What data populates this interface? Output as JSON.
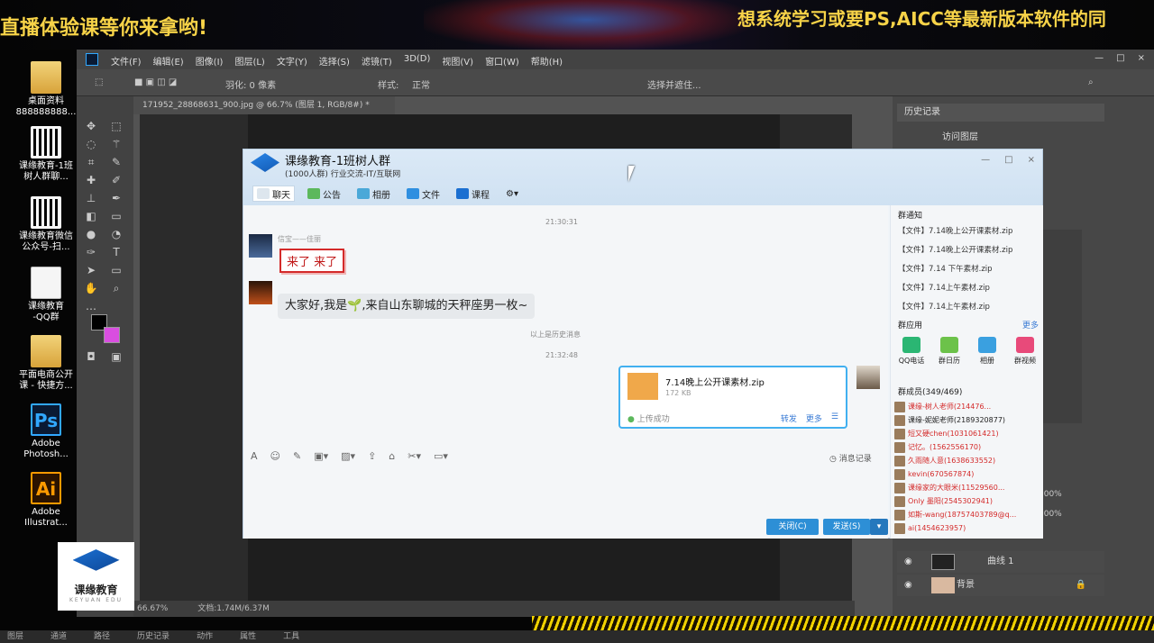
{
  "banner": {
    "left_text": "直播体验课等你来拿哟!",
    "right_text": "想系统学习或要PS,AICC等最新版本软件的同"
  },
  "desktop": {
    "icons": [
      {
        "label": "桌面资料\n888888888...",
        "kind": "folder"
      },
      {
        "label": "课缘教育-1班\n树人群聊...",
        "kind": "qr"
      },
      {
        "label": "课缘教育微信\n公众号-扫...",
        "kind": "qr"
      },
      {
        "label": "课缘教育\n-QQ群",
        "kind": "doc"
      },
      {
        "label": "平面电商公开\n课 - 快捷方...",
        "kind": "folder"
      },
      {
        "label": "Adobe\nPhotosh...",
        "kind": "ps"
      },
      {
        "label": "Adobe\nIllustrat...",
        "kind": "ai"
      }
    ],
    "logo_text": "课缘教育",
    "logo_sub": "KEYUAN EDU"
  },
  "photoshop": {
    "menus": [
      "文件(F)",
      "编辑(E)",
      "图像(I)",
      "图层(L)",
      "文字(Y)",
      "选择(S)",
      "滤镜(T)",
      "3D(D)",
      "视图(V)",
      "窗口(W)",
      "帮助(H)"
    ],
    "options": {
      "feather": "羽化: 0 像素",
      "style_label": "样式:",
      "style_value": "正常",
      "select_mask": "选择并遮住..."
    },
    "doc_tab": "171952_28868631_900.jpg @ 66.7% (图层 1, RGB/8#) *",
    "status": {
      "zoom": "66.67%",
      "doc": "文档:1.74M/6.37M"
    },
    "history_panel": "历史记录",
    "history_item": "访问图层",
    "layers": [
      {
        "name": "曲线 1"
      },
      {
        "name": "背景"
      }
    ],
    "opacity_values": [
      "100%",
      "100%"
    ]
  },
  "qq": {
    "title": "课缘教育-1班树人群",
    "subtitle": "(1000人群) 行业交流-IT/互联网",
    "tabs": [
      "聊天",
      "公告",
      "相册",
      "文件",
      "课程"
    ],
    "window_controls": [
      "—",
      "□",
      "×"
    ],
    "messages": {
      "time1": "21:30:31",
      "sender1": "信宝——佳丽",
      "sticker_text": "来了 来了",
      "bubble_text": "大家好,我是🌱,来自山东聊城的天秤座男一枚~",
      "hint": "以上是历史消息",
      "time2": "21:32:48"
    },
    "file": {
      "name": "7.14晚上公开课素材.zip",
      "size": "172 KB",
      "status": "上传成功",
      "actions": [
        "转发",
        "更多"
      ]
    },
    "toolbar_history": "消息记录",
    "buttons": {
      "close": "关闭(C)",
      "send": "发送(S)"
    },
    "side": {
      "notice_title": "群通知",
      "notices": [
        "【文件】7.14晚上公开课素材.zip",
        "【文件】7.14晚上公开课素材.zip",
        "【文件】7.14 下午素材.zip",
        "【文件】7.14上午素材.zip",
        "【文件】7.14上午素材.zip"
      ],
      "apps_title": "群应用",
      "apps_more": "更多",
      "apps": [
        "QQ电话",
        "群日历",
        "相册",
        "群视频"
      ],
      "members_title": "群成员(349/469)",
      "members": [
        {
          "name": "课缘-树人老师(214476...",
          "color": "#d42a2a"
        },
        {
          "name": "课缘-妮妮老师(2189320877)",
          "color": "#222222"
        },
        {
          "name": "短又硬chen(1031061421)",
          "color": "#d42a2a"
        },
        {
          "name": "记忆。(1562556170)",
          "color": "#d42a2a"
        },
        {
          "name": "久雨随人意(1638633552)",
          "color": "#d42a2a"
        },
        {
          "name": "kevin(670567874)",
          "color": "#d42a2a"
        },
        {
          "name": "课缘家的大眼米(11529560...",
          "color": "#d42a2a"
        },
        {
          "name": "Only 墨阳(2545302941)",
          "color": "#d42a2a"
        },
        {
          "name": "如斯-wang(18757403789@q...",
          "color": "#d42a2a"
        },
        {
          "name": "ai(1454623957)",
          "color": "#d42a2a"
        }
      ]
    }
  },
  "taskbar": [
    "图层",
    "通道",
    "路径",
    "历史记录",
    "动作",
    "属性",
    "工具"
  ]
}
